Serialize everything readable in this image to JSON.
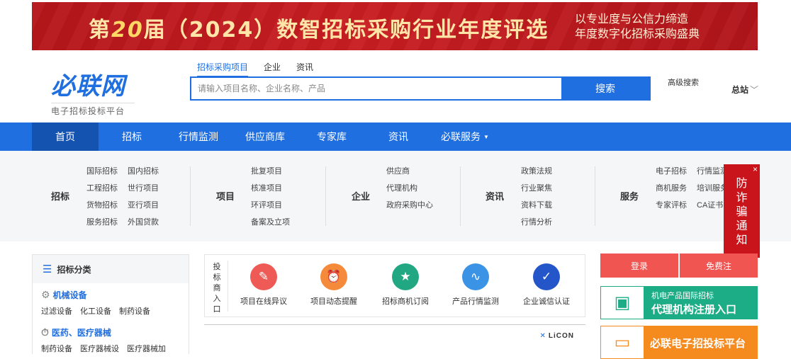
{
  "banner": {
    "headline_prefix": "第",
    "headline_num": "20",
    "headline_rest": "届（2024）数智招标采购行业年度评选",
    "sub_line1": "以专业度与公信力缔造",
    "sub_line2": "年度数字化招标采购盛典"
  },
  "logo": {
    "name": "必联网",
    "tagline": "电子招标投标平台"
  },
  "search": {
    "tabs": [
      "招标采购项目",
      "企业",
      "资讯"
    ],
    "active_tab": 0,
    "placeholder": "请输入项目名称、企业名称、产品",
    "button": "搜索",
    "advanced": "高级搜索",
    "station": "总站",
    "station_chevron": "﹀"
  },
  "nav": {
    "items": [
      "首页",
      "招标",
      "行情监测",
      "供应商库",
      "专家库",
      "资讯",
      "必联服务"
    ],
    "caret": "▼"
  },
  "categories": [
    {
      "head": "招标",
      "cols": [
        [
          "国际招标",
          "工程招标",
          "货物招标",
          "服务招标"
        ],
        [
          "国内招标",
          "世行项目",
          "亚行项目",
          "外国贷款"
        ]
      ]
    },
    {
      "head": "项目",
      "cols": [
        [
          "批复项目",
          "核准项目",
          "环评项目",
          "备案及立项"
        ]
      ]
    },
    {
      "head": "企业",
      "cols": [
        [
          "供应商",
          "代理机构",
          "政府采购中心"
        ]
      ]
    },
    {
      "head": "资讯",
      "cols": [
        [
          "政策法规",
          "行业聚焦",
          "资料下载",
          "行情分析"
        ]
      ]
    },
    {
      "head": "服务",
      "cols": [
        [
          "电子招标",
          "商机服务",
          "专家评标"
        ],
        [
          "行情监测",
          "培训服务",
          "CA证书"
        ]
      ]
    }
  ],
  "scam_notice": {
    "close": "×",
    "chars": [
      "防",
      "诈",
      "骗",
      "通",
      "知"
    ],
    "speaker": "🔊"
  },
  "left_panel": {
    "title": "招标分类",
    "sections": [
      {
        "title": "机械设备",
        "icon": "⚙",
        "links": [
          "过滤设备",
          "化工设备",
          "制药设备"
        ]
      },
      {
        "title": "医药、医疗器械",
        "icon": "⏱",
        "links": [
          "制药设备",
          "医疗器械设",
          "医疗器械加"
        ]
      }
    ]
  },
  "services": {
    "label_chars": [
      "投",
      "标",
      "商",
      "入",
      "口"
    ],
    "items": [
      {
        "label": "项目在线异议",
        "color": "#ee5a55",
        "glyph": "✎"
      },
      {
        "label": "项目动态提醒",
        "color": "#f58a3a",
        "glyph": "⏰"
      },
      {
        "label": "招标商机订阅",
        "color": "#21a883",
        "glyph": "★"
      },
      {
        "label": "产品行情监测",
        "color": "#3b93e6",
        "glyph": "∿"
      },
      {
        "label": "企业诚信认证",
        "color": "#2456c9",
        "glyph": "✓"
      }
    ]
  },
  "bottom_strip": {
    "brand": "LiCON"
  },
  "right_panel": {
    "login": "登录",
    "register": "免费注",
    "promo1_line1": "机电产品国际招标",
    "promo1_line2": "代理机构注册入口",
    "promo2_line2": "必联电子招投标平台"
  }
}
